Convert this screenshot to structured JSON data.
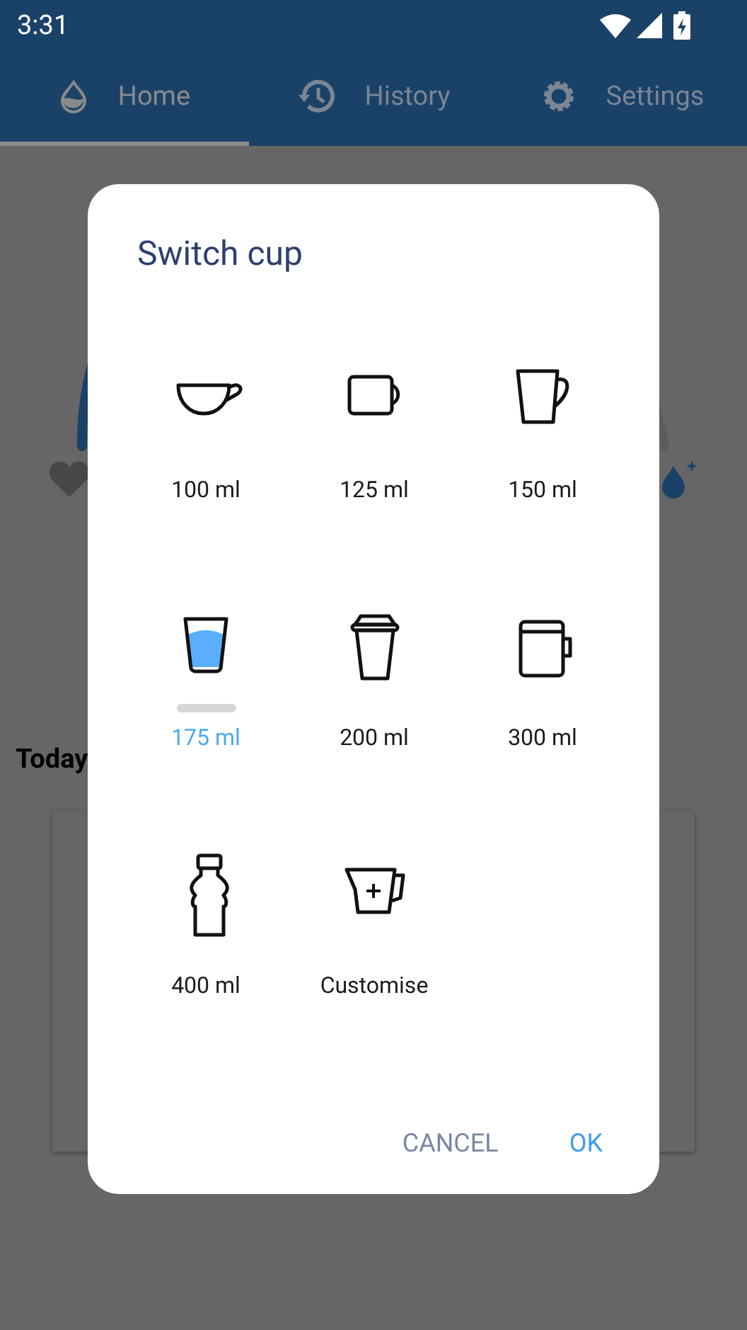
{
  "status_bar": {
    "time": "3:31"
  },
  "tabs": [
    {
      "label": "Home",
      "kind": "drop",
      "selected": true
    },
    {
      "label": "History",
      "kind": "history",
      "selected": false
    },
    {
      "label": "Settings",
      "kind": "gear",
      "selected": false
    }
  ],
  "today": {
    "heading": "Today"
  },
  "dialog": {
    "title": "Switch cup",
    "cups": [
      {
        "label": "100 ml",
        "kind": "teacup",
        "selected": false
      },
      {
        "label": "125 ml",
        "kind": "mug",
        "selected": false
      },
      {
        "label": "150 ml",
        "kind": "tapered",
        "selected": false
      },
      {
        "label": "175 ml",
        "kind": "glass",
        "selected": true
      },
      {
        "label": "200 ml",
        "kind": "takeaway",
        "selected": false
      },
      {
        "label": "300 ml",
        "kind": "jar",
        "selected": false
      },
      {
        "label": "400 ml",
        "kind": "bottle",
        "selected": false
      },
      {
        "label": "Customise",
        "kind": "jug",
        "selected": false
      }
    ],
    "buttons": [
      {
        "label": "CANCEL",
        "kind": "secondary"
      },
      {
        "label": "OK",
        "kind": "primary"
      }
    ]
  }
}
